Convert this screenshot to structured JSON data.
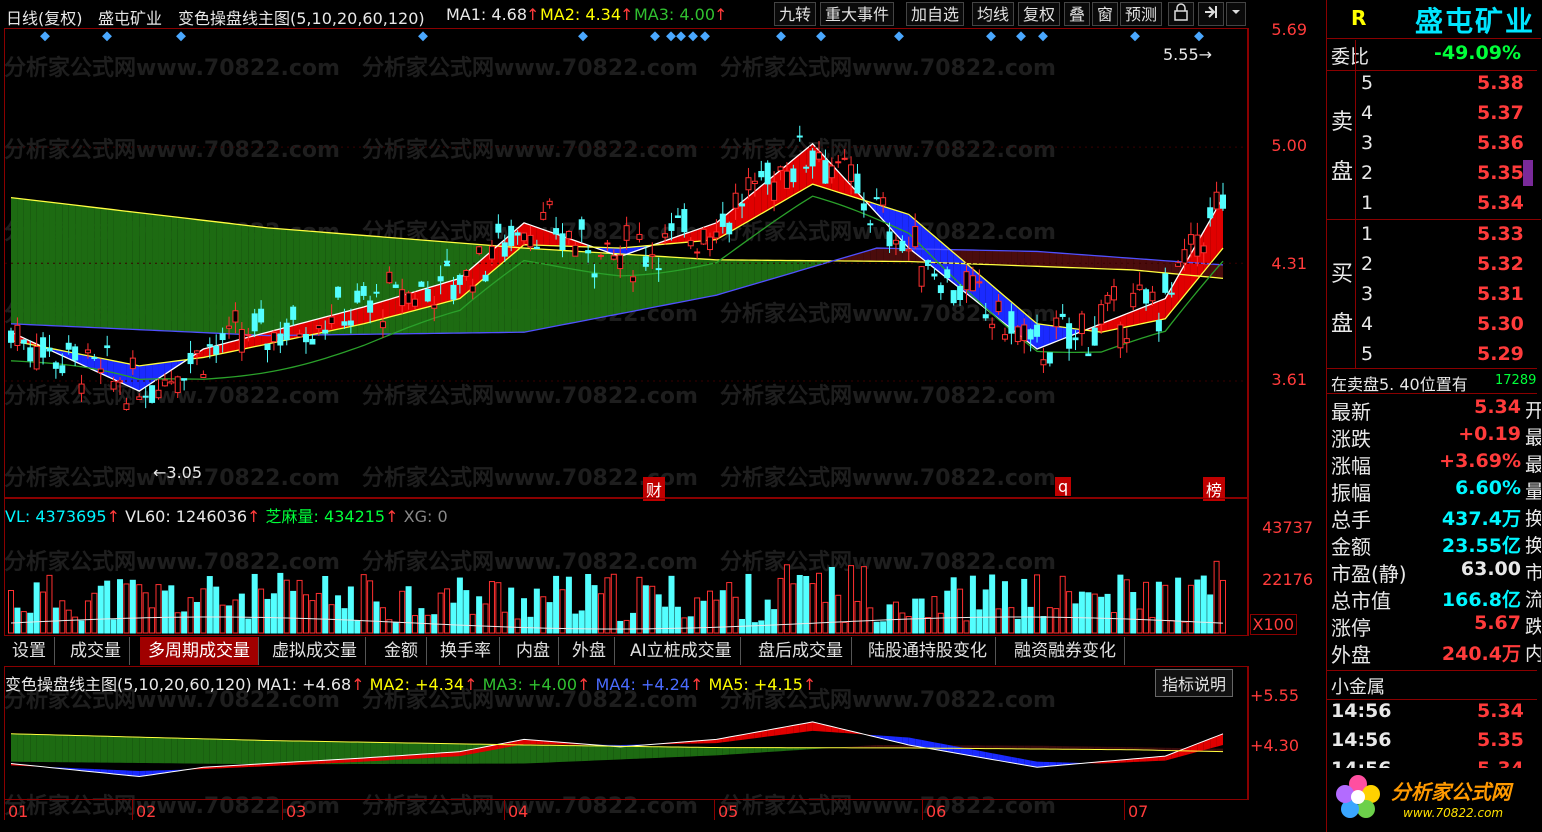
{
  "toolbar": {
    "period": "日线(复权)",
    "stock_name": "盛屯矿业",
    "indicator": "变色操盘线主图(5,10,20,60,120)",
    "ma1": "MA1: 4.68",
    "ma2": "MA2: 4.34",
    "ma3": "MA3: 4.00",
    "buttons": [
      "九转",
      "重大事件",
      "加自选",
      "均线",
      "复权",
      "叠",
      "窗",
      "预测"
    ]
  },
  "price_axis": [
    "5.69",
    "5.00",
    "4.31",
    "3.61"
  ],
  "price_annotations": {
    "high": "5.55",
    "low": "3.05"
  },
  "chart_markers": [
    "财",
    "q",
    "榜"
  ],
  "volume_header": {
    "vl": "VL: 4373695",
    "vl60": "VL60: 1246036",
    "zml": "芝麻量: 434215",
    "xg": "XG: 0"
  },
  "volume_axis": [
    "43737",
    "22176",
    "X100"
  ],
  "tabs": [
    "设置",
    "成交量",
    "多周期成交量",
    "虚拟成交量",
    "金额",
    "换手率",
    "内盘",
    "外盘",
    "AI立桩成交量",
    "盘后成交量",
    "陆股通持股变化",
    "融资融券变化"
  ],
  "active_tab": 2,
  "mini_header": {
    "title": "变色操盘线主图(5,10,20,60,120)",
    "ma1": "MA1: +4.68",
    "ma2": "MA2: +4.34",
    "ma3": "MA3: +4.00",
    "ma4": "MA4: +4.24",
    "ma5": "MA5: +4.15",
    "help_button": "指标说明"
  },
  "mini_axis": [
    "+5.55",
    "+4.30"
  ],
  "months": [
    "01",
    "02",
    "03",
    "04",
    "05",
    "06",
    "07"
  ],
  "watermark": "分析家公式网www.70822.com",
  "panel": {
    "r_mark": "R",
    "title": "盛屯矿业",
    "weibi_label": "委比",
    "weibi_value": "-49.09%",
    "sell_label_1": "卖",
    "sell_label_2": "盘",
    "buy_label_1": "买",
    "buy_label_2": "盘",
    "sell": [
      {
        "level": "5",
        "price": "5.38"
      },
      {
        "level": "4",
        "price": "5.37"
      },
      {
        "level": "3",
        "price": "5.36"
      },
      {
        "level": "2",
        "price": "5.35"
      },
      {
        "level": "1",
        "price": "5.34"
      }
    ],
    "buy": [
      {
        "level": "1",
        "price": "5.33"
      },
      {
        "level": "2",
        "price": "5.32"
      },
      {
        "level": "3",
        "price": "5.31"
      },
      {
        "level": "4",
        "price": "5.30"
      },
      {
        "level": "5",
        "price": "5.29"
      }
    ],
    "notice": "在卖盘5. 40位置有",
    "notice_value": "17289",
    "stats": [
      {
        "label": "最新",
        "value": "5.34",
        "cut": "开"
      },
      {
        "label": "涨跌",
        "value": "+0.19",
        "cut": "最"
      },
      {
        "label": "涨幅",
        "value": "+3.69%",
        "cut": "最"
      },
      {
        "label": "振幅",
        "value": "6.60%",
        "cut": "量"
      },
      {
        "label": "总手",
        "value": "437.4万",
        "cut": "换"
      },
      {
        "label": "金额",
        "value": "23.55亿",
        "cut": "换"
      },
      {
        "label": "市盈(静)",
        "value": "63.00",
        "cut": "市"
      },
      {
        "label": "总市值",
        "value": "166.8亿",
        "cut": "流"
      },
      {
        "label": "涨停",
        "value": "5.67",
        "cut": "跌"
      },
      {
        "label": "外盘",
        "value": "240.4万",
        "cut": "内"
      }
    ],
    "sector": "小金属",
    "ticks": [
      {
        "time": "14:56",
        "price": "5.34"
      },
      {
        "time": "14:56",
        "price": "5.35"
      },
      {
        "time": "14:56",
        "price": "5.34"
      }
    ],
    "logo_text": "分析家公式网",
    "logo_url": "www.70822.com"
  }
}
